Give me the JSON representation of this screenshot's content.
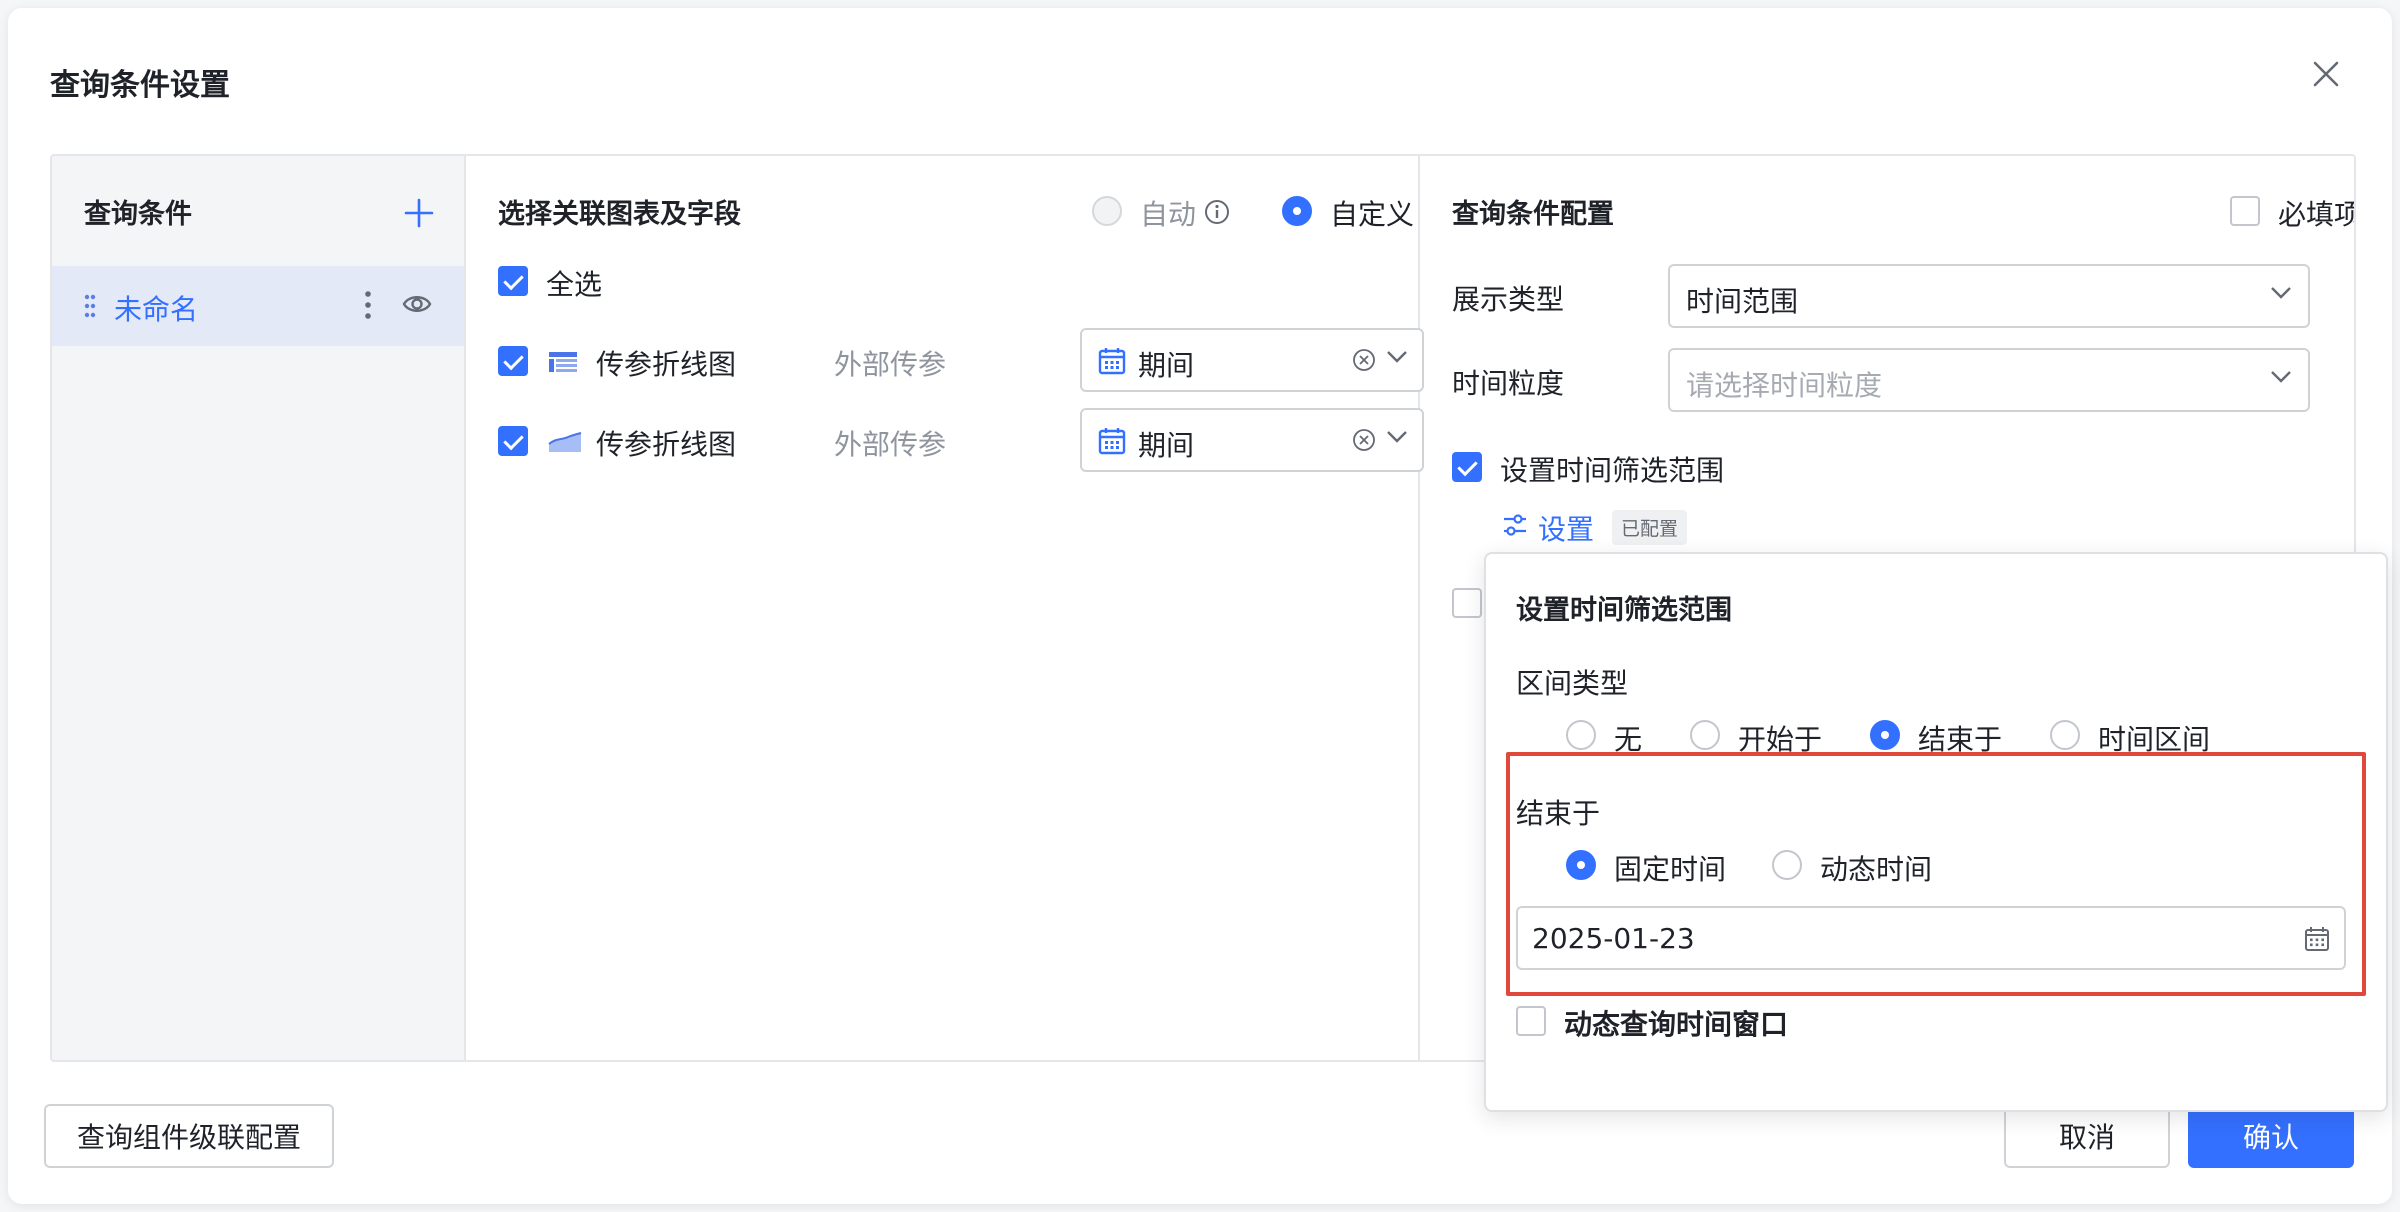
{
  "dialog": {
    "title": "查询条件设置"
  },
  "left": {
    "title": "查询条件",
    "items": [
      {
        "label": "未命名"
      }
    ]
  },
  "middle": {
    "title": "选择关联图表及字段",
    "mode_auto": "自动",
    "mode_custom": "自定义",
    "select_all": "全选",
    "rows": [
      {
        "chart": "传参折线图",
        "param_type": "外部传参",
        "field": "期间"
      },
      {
        "chart": "传参折线图",
        "param_type": "外部传参",
        "field": "期间"
      }
    ]
  },
  "right": {
    "title": "查询条件配置",
    "required": "必填项",
    "display_type_label": "展示类型",
    "display_type_value": "时间范围",
    "granularity_label": "时间粒度",
    "granularity_placeholder": "请选择时间粒度",
    "filter_range_label": "设置时间筛选范围",
    "settings_link": "设置",
    "configured_tag": "已配置"
  },
  "popover": {
    "title": "设置时间筛选范围",
    "interval_type_label": "区间类型",
    "interval_options": [
      "无",
      "开始于",
      "结束于",
      "时间区间"
    ],
    "end_at_label": "结束于",
    "time_options": [
      "固定时间",
      "动态时间"
    ],
    "date_value": "2025-01-23",
    "dynamic_window": "动态查询时间窗口"
  },
  "footer": {
    "cascade_button": "查询组件级联配置",
    "cancel": "取消",
    "confirm": "确认"
  },
  "colors": {
    "accent": "#3370ff",
    "highlight": "#e0483b",
    "selected_bg": "#e4e9f7"
  },
  "icons": [
    "close-icon",
    "plus-icon",
    "drag-handle-icon",
    "more-icon",
    "eye-icon",
    "info-icon",
    "table-chart-icon",
    "area-chart-icon",
    "calendar-icon",
    "clear-icon",
    "chevron-down-icon",
    "sliders-icon"
  ]
}
